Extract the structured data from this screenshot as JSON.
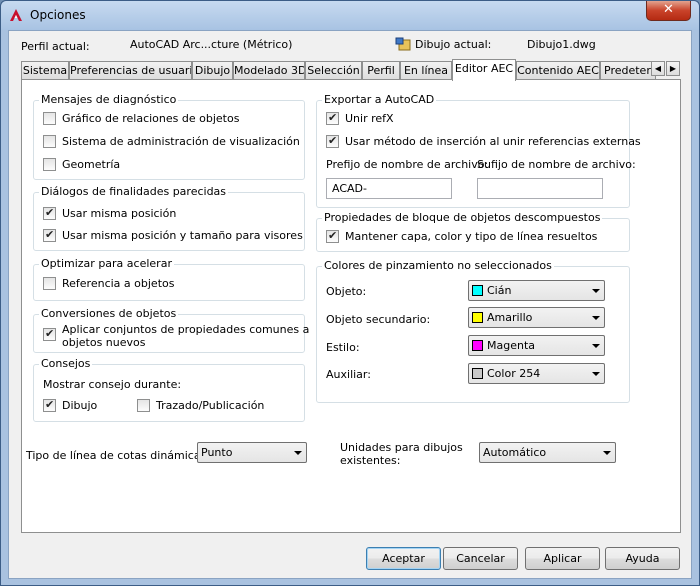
{
  "window": {
    "title": "Opciones",
    "close_label": "✕"
  },
  "header": {
    "profile_label": "Perfil actual:",
    "profile_value": "AutoCAD Arc...cture (Métrico)",
    "drawing_label": "Dibujo actual:",
    "drawing_value": "Dibujo1.dwg"
  },
  "tabs": [
    "Sistema",
    "Preferencias de usuario",
    "Dibujo",
    "Modelado 3D",
    "Selección",
    "Perfil",
    "En línea",
    "Editor AEC",
    "Contenido AEC",
    "Predeterm"
  ],
  "active_tab": "Editor AEC",
  "diagnostics": {
    "title": "Mensajes de diagnóstico",
    "items": [
      {
        "label": "Gráfico de relaciones de objetos",
        "checked": false
      },
      {
        "label": "Sistema de administración de visualización",
        "checked": false
      },
      {
        "label": "Geometría",
        "checked": false
      }
    ]
  },
  "similar_dialogs": {
    "title": "Diálogos de finalidades parecidas",
    "items": [
      {
        "label": "Usar misma posición",
        "checked": true
      },
      {
        "label": "Usar misma posición y tamaño para visores",
        "checked": true
      }
    ]
  },
  "optimize": {
    "title": "Optimizar para acelerar",
    "items": [
      {
        "label": "Referencia a objetos",
        "checked": false
      }
    ]
  },
  "conversions": {
    "title": "Conversiones de objetos",
    "items": [
      {
        "label_line1": "Aplicar conjuntos de propiedades comunes a",
        "label_line2": "objetos nuevos",
        "checked": true
      }
    ]
  },
  "tips": {
    "title": "Consejos",
    "show_during": "Mostrar consejo durante:",
    "items": [
      {
        "label": "Dibujo",
        "checked": true
      },
      {
        "label": "Trazado/Publicación",
        "checked": false
      }
    ]
  },
  "dimension_linetype": {
    "label": "Tipo de línea de cotas dinámicas:",
    "value": "Punto"
  },
  "export": {
    "title": "Exportar a AutoCAD",
    "items": [
      {
        "label": "Unir refX",
        "checked": true
      },
      {
        "label": "Usar método de inserción al unir referencias externas",
        "checked": true
      }
    ],
    "prefix_label": "Prefijo de nombre de archivo:",
    "prefix_value": "ACAD-",
    "suffix_label": "Sufijo de nombre de archivo:",
    "suffix_value": ""
  },
  "block_props": {
    "title": "Propiedades de bloque de objetos descompuestos",
    "items": [
      {
        "label": "Mantener capa, color y tipo de línea resueltos",
        "checked": true
      }
    ]
  },
  "grip_colors": {
    "title": "Colores de pinzamiento no seleccionados",
    "rows": [
      {
        "label": "Objeto:",
        "value": "Cián",
        "color": "#00ffff"
      },
      {
        "label": "Objeto secundario:",
        "value": "Amarillo",
        "color": "#ffff00"
      },
      {
        "label": "Estilo:",
        "value": "Magenta",
        "color": "#ff00ff"
      },
      {
        "label": "Auxiliar:",
        "value": "Color 254",
        "color": "#c8c8c8"
      }
    ]
  },
  "units": {
    "label_line1": "Unidades para dibujos",
    "label_line2": "existentes:",
    "value": "Automático"
  },
  "buttons": {
    "ok": "Aceptar",
    "cancel": "Cancelar",
    "apply": "Aplicar",
    "help": "Ayuda"
  },
  "colors": {
    "accent": "#3c7fb1",
    "close": "#c9432a"
  }
}
